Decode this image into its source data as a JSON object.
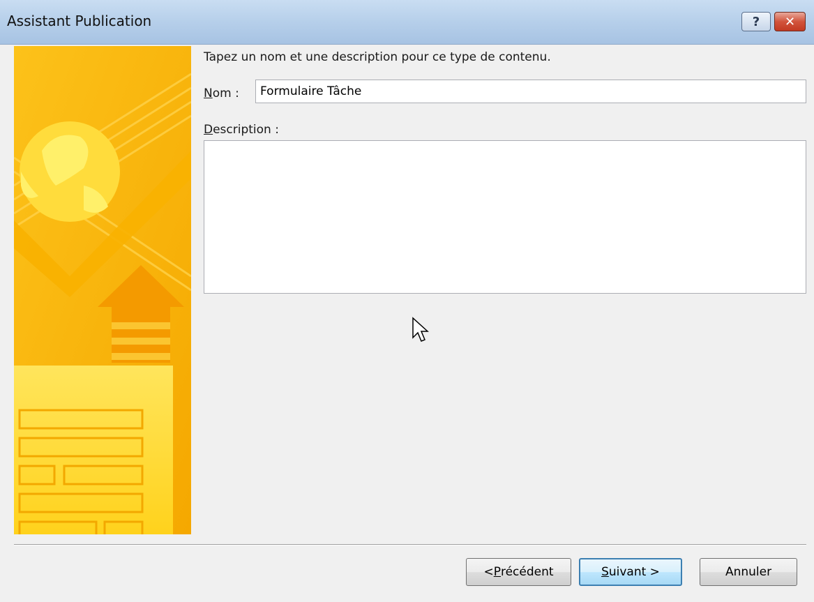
{
  "window": {
    "title": "Assistant Publication",
    "help_glyph": "?",
    "close_glyph": "✕"
  },
  "main": {
    "instruction": "Tapez un nom et une description pour ce type de contenu.",
    "name_label_key": "N",
    "name_label_rest": "om :",
    "name_value": "Formulaire Tâche",
    "description_label_key": "D",
    "description_label_rest": "escription :",
    "description_value": ""
  },
  "buttons": {
    "previous_prefix": "< ",
    "previous_key": "P",
    "previous_rest": "récédent",
    "next_key": "S",
    "next_rest": "uivant >",
    "cancel": "Annuler"
  },
  "colors": {
    "side_art_primary": "#f7b500",
    "side_art_light": "#ffe04a",
    "title_bar": "#b6cfea"
  },
  "icons": [
    "help-icon",
    "close-icon",
    "globe-icon",
    "up-arrow-icon",
    "mouse-cursor-icon"
  ]
}
